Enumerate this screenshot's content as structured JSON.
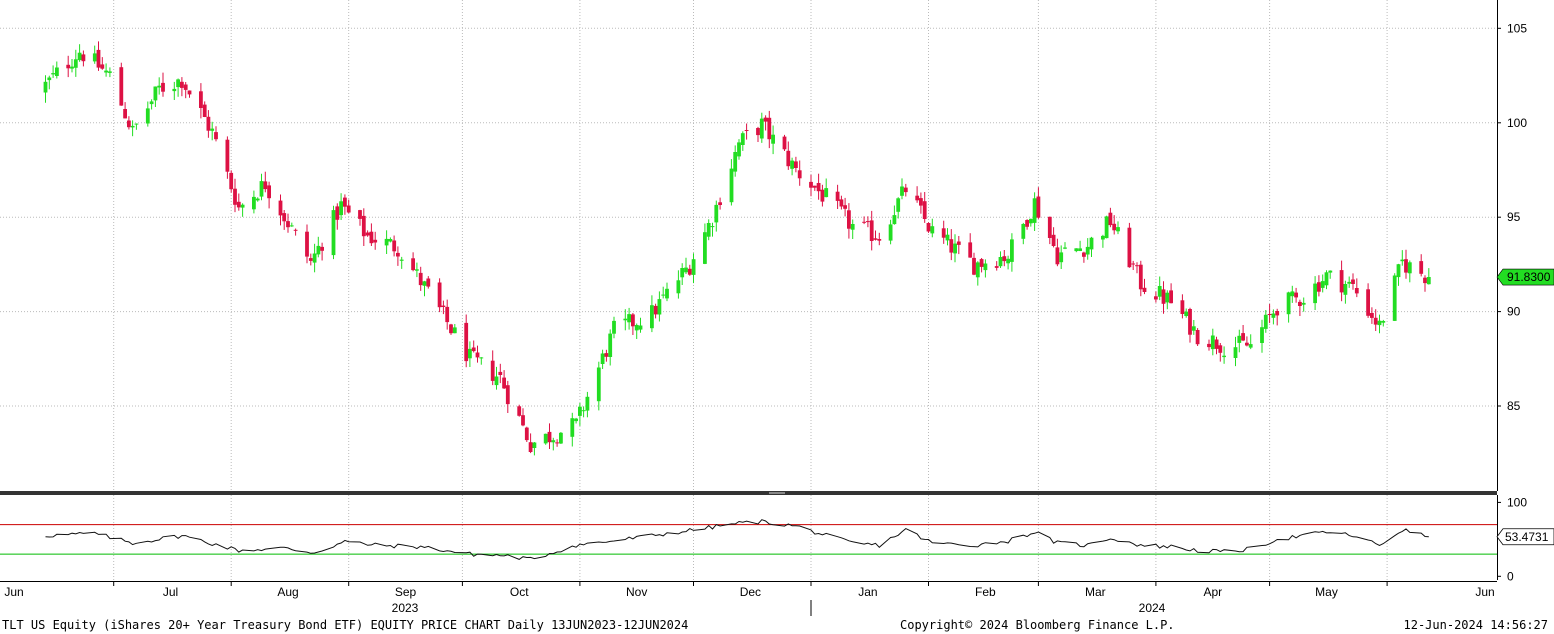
{
  "footer": {
    "description": "TLT US Equity (iShares 20+ Year Treasury Bond ETF) EQUITY PRICE CHART  Daily 13JUN2023-12JUN2024",
    "copyright": "Copyright© 2024 Bloomberg Finance L.P.",
    "timestamp": "12-Jun-2024 14:56:27"
  },
  "colors": {
    "up": "#22dd22",
    "down": "#dd1144",
    "grid": "#bbbbbb",
    "rsi_line": "#111111",
    "overbought": "#cc0000",
    "oversold": "#00bb00",
    "badge_price": "#22dd22",
    "badge_rsi": "#ffffff"
  },
  "chart_data": [
    {
      "type": "candlestick",
      "title": "",
      "ylim": [
        80.5,
        106.5
      ],
      "y_ticks": [
        "105",
        "100",
        "95",
        "90",
        "85"
      ],
      "last_value_label": "91.8300",
      "x_month_labels": [
        "Jun",
        "Jul",
        "Aug",
        "Sep",
        "Oct",
        "Nov",
        "Dec",
        "Jan",
        "Feb",
        "Mar",
        "Apr",
        "May",
        "Jun"
      ],
      "x_year_labels": [
        "2023",
        "2024"
      ],
      "daily_ohlc_anchors": [
        [
          "2023-06-13",
          102.0
        ],
        [
          "2023-06-22",
          103.8
        ],
        [
          "2023-06-30",
          102.5
        ],
        [
          "2023-07-06",
          99.5
        ],
        [
          "2023-07-13",
          101.8
        ],
        [
          "2023-07-19",
          102.3
        ],
        [
          "2023-07-27",
          99.5
        ],
        [
          "2023-08-03",
          95.5
        ],
        [
          "2023-08-10",
          96.8
        ],
        [
          "2023-08-22",
          92.6
        ],
        [
          "2023-08-30",
          95.6
        ],
        [
          "2023-09-06",
          94.0
        ],
        [
          "2023-09-14",
          93.4
        ],
        [
          "2023-09-22",
          91.0
        ],
        [
          "2023-10-03",
          87.5
        ],
        [
          "2023-10-11",
          86.5
        ],
        [
          "2023-10-19",
          83.0
        ],
        [
          "2023-10-31",
          84.0
        ],
        [
          "2023-11-10",
          89.0
        ],
        [
          "2023-11-20",
          89.9
        ],
        [
          "2023-11-30",
          92.5
        ],
        [
          "2023-12-06",
          95.0
        ],
        [
          "2023-12-13",
          98.9
        ],
        [
          "2023-12-19",
          99.9
        ],
        [
          "2023-12-28",
          97.5
        ],
        [
          "2024-01-05",
          96.0
        ],
        [
          "2024-01-12",
          94.5
        ],
        [
          "2024-01-19",
          94.0
        ],
        [
          "2024-01-26",
          96.5
        ],
        [
          "2024-02-02",
          94.2
        ],
        [
          "2024-02-13",
          92.5
        ],
        [
          "2024-02-22",
          93.0
        ],
        [
          "2024-02-29",
          95.8
        ],
        [
          "2024-03-06",
          93.0
        ],
        [
          "2024-03-14",
          93.5
        ],
        [
          "2024-03-20",
          94.8
        ],
        [
          "2024-03-28",
          91.5
        ],
        [
          "2024-04-05",
          90.5
        ],
        [
          "2024-04-12",
          88.8
        ],
        [
          "2024-04-19",
          88.2
        ],
        [
          "2024-04-26",
          88.2
        ],
        [
          "2024-05-03",
          90.3
        ],
        [
          "2024-05-10",
          90.8
        ],
        [
          "2024-05-16",
          91.9
        ],
        [
          "2024-05-23",
          91.3
        ],
        [
          "2024-05-30",
          89.2
        ],
        [
          "2024-06-05",
          92.6
        ],
        [
          "2024-06-12",
          91.83
        ]
      ]
    },
    {
      "type": "line",
      "title": "",
      "ylim": [
        -5,
        110
      ],
      "y_ticks": [
        "100",
        "0"
      ],
      "overbought": 70,
      "oversold": 30,
      "last_value_label": "53.4731",
      "rsi_anchors": [
        [
          "2023-06-13",
          55
        ],
        [
          "2023-06-26",
          58
        ],
        [
          "2023-07-06",
          45
        ],
        [
          "2023-07-19",
          55
        ],
        [
          "2023-08-03",
          35
        ],
        [
          "2023-08-15",
          38
        ],
        [
          "2023-08-23",
          32
        ],
        [
          "2023-08-31",
          47
        ],
        [
          "2023-09-08",
          42
        ],
        [
          "2023-09-20",
          40
        ],
        [
          "2023-10-03",
          30
        ],
        [
          "2023-10-12",
          28
        ],
        [
          "2023-10-19",
          23
        ],
        [
          "2023-10-31",
          42
        ],
        [
          "2023-11-10",
          48
        ],
        [
          "2023-11-30",
          62
        ],
        [
          "2023-12-13",
          72
        ],
        [
          "2023-12-19",
          74
        ],
        [
          "2023-12-28",
          68
        ],
        [
          "2024-01-05",
          55
        ],
        [
          "2024-01-12",
          45
        ],
        [
          "2024-01-19",
          42
        ],
        [
          "2024-01-26",
          63
        ],
        [
          "2024-02-02",
          45
        ],
        [
          "2024-02-13",
          42
        ],
        [
          "2024-02-22",
          48
        ],
        [
          "2024-02-29",
          60
        ],
        [
          "2024-03-06",
          45
        ],
        [
          "2024-03-14",
          42
        ],
        [
          "2024-03-20",
          52
        ],
        [
          "2024-03-28",
          42
        ],
        [
          "2024-04-05",
          40
        ],
        [
          "2024-04-12",
          35
        ],
        [
          "2024-04-19",
          33
        ],
        [
          "2024-04-26",
          37
        ],
        [
          "2024-05-03",
          50
        ],
        [
          "2024-05-10",
          55
        ],
        [
          "2024-05-16",
          60
        ],
        [
          "2024-05-23",
          55
        ],
        [
          "2024-05-30",
          42
        ],
        [
          "2024-06-05",
          63
        ],
        [
          "2024-06-12",
          53.47
        ]
      ]
    }
  ]
}
